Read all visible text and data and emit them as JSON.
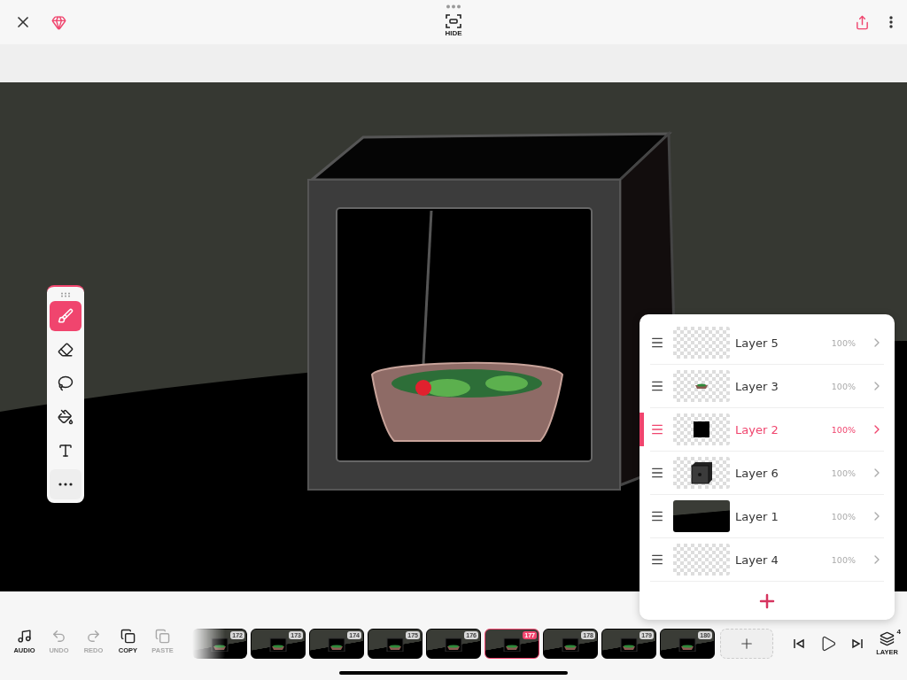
{
  "top_bar": {
    "hide_label": "HIDE"
  },
  "tools": [
    {
      "kind": "brush",
      "selected": true
    },
    {
      "kind": "eraser",
      "selected": false
    },
    {
      "kind": "lasso",
      "selected": false
    },
    {
      "kind": "fill",
      "selected": false
    },
    {
      "kind": "text",
      "selected": false
    },
    {
      "kind": "more",
      "selected": false
    }
  ],
  "layers": [
    {
      "name": "Layer 5",
      "opacity": "100%",
      "kind": "empty",
      "selected": false
    },
    {
      "name": "Layer 3",
      "opacity": "100%",
      "kind": "bowl",
      "selected": false
    },
    {
      "name": "Layer 2",
      "opacity": "100%",
      "kind": "square",
      "selected": true
    },
    {
      "name": "Layer 6",
      "opacity": "100%",
      "kind": "box",
      "selected": false
    },
    {
      "name": "Layer 1",
      "opacity": "100%",
      "kind": "background",
      "selected": false
    },
    {
      "name": "Layer 4",
      "opacity": "100%",
      "kind": "empty",
      "selected": false
    }
  ],
  "actions": [
    {
      "kind": "audio",
      "label": "AUDIO",
      "disabled": false
    },
    {
      "kind": "undo",
      "label": "UNDO",
      "disabled": true
    },
    {
      "kind": "redo",
      "label": "REDO",
      "disabled": true
    },
    {
      "kind": "copy",
      "label": "COPY",
      "disabled": false
    },
    {
      "kind": "paste",
      "label": "PASTE",
      "disabled": true
    }
  ],
  "frames": [
    {
      "label": "172",
      "selected": false
    },
    {
      "label": "173",
      "selected": false
    },
    {
      "label": "174",
      "selected": false
    },
    {
      "label": "175",
      "selected": false
    },
    {
      "label": "176",
      "selected": false
    },
    {
      "label": "177",
      "selected": true
    },
    {
      "label": "178",
      "selected": false
    },
    {
      "label": "179",
      "selected": false
    },
    {
      "label": "180",
      "selected": false
    }
  ],
  "layer_button": {
    "label": "LAYER",
    "count": "4"
  }
}
